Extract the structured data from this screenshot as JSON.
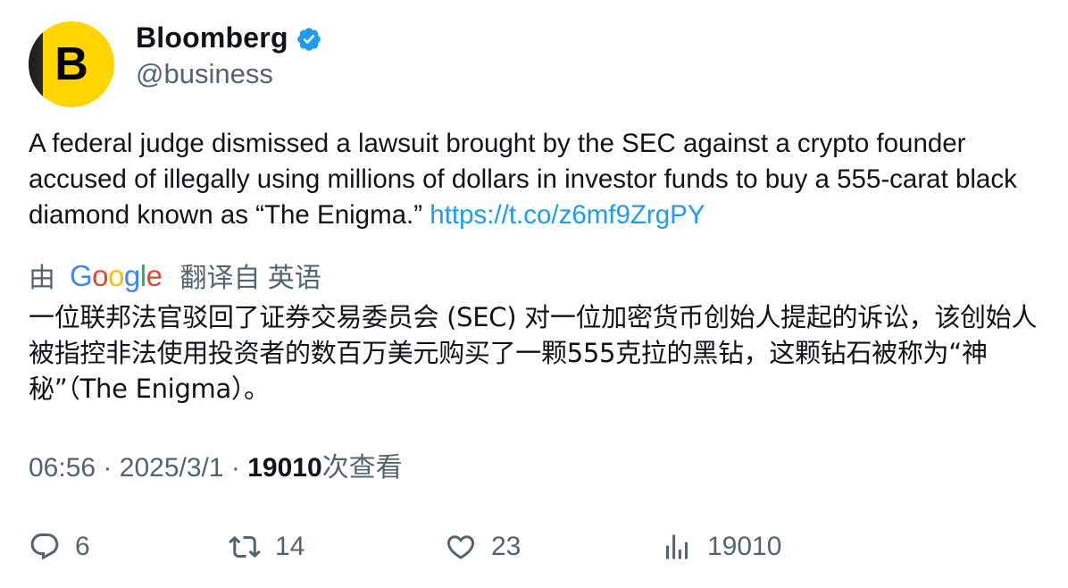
{
  "tweet": {
    "display_name": "Bloomberg",
    "handle": "@business",
    "avatar_letter": "B",
    "text": "A federal judge dismissed a lawsuit brought by the SEC against a crypto founder accused of illegally using millions of dollars in investor funds to buy a 555-carat black diamond known as “The Enigma.”",
    "link": "https://t.co/z6mf9ZrgPY",
    "translate_prefix": "由",
    "translate_suffix": "翻译自 英语",
    "translated_text": "一位联邦法官驳回了证券交易委员会 (SEC) 对一位加密货币创始人提起的诉讼，该创始人被指控非法使用投资者的数百万美元购买了一颗555克拉的黑钻，这颗钻石被称为“神秘”（The Enigma）。",
    "time": "06:56",
    "date": "2025/3/1",
    "views_count": "19010",
    "views_label": "次查看",
    "separator": "·"
  },
  "actions": {
    "replies": "6",
    "retweets": "14",
    "likes": "23",
    "views": "19010"
  },
  "google_logo": {
    "letters": [
      "G",
      "o",
      "o",
      "g",
      "l",
      "e"
    ]
  },
  "colors": {
    "brand_yellow": "#ffd400",
    "link": "#1d9bf0",
    "verified": "#1d9bf0",
    "muted": "#536471",
    "text": "#0f1419"
  }
}
